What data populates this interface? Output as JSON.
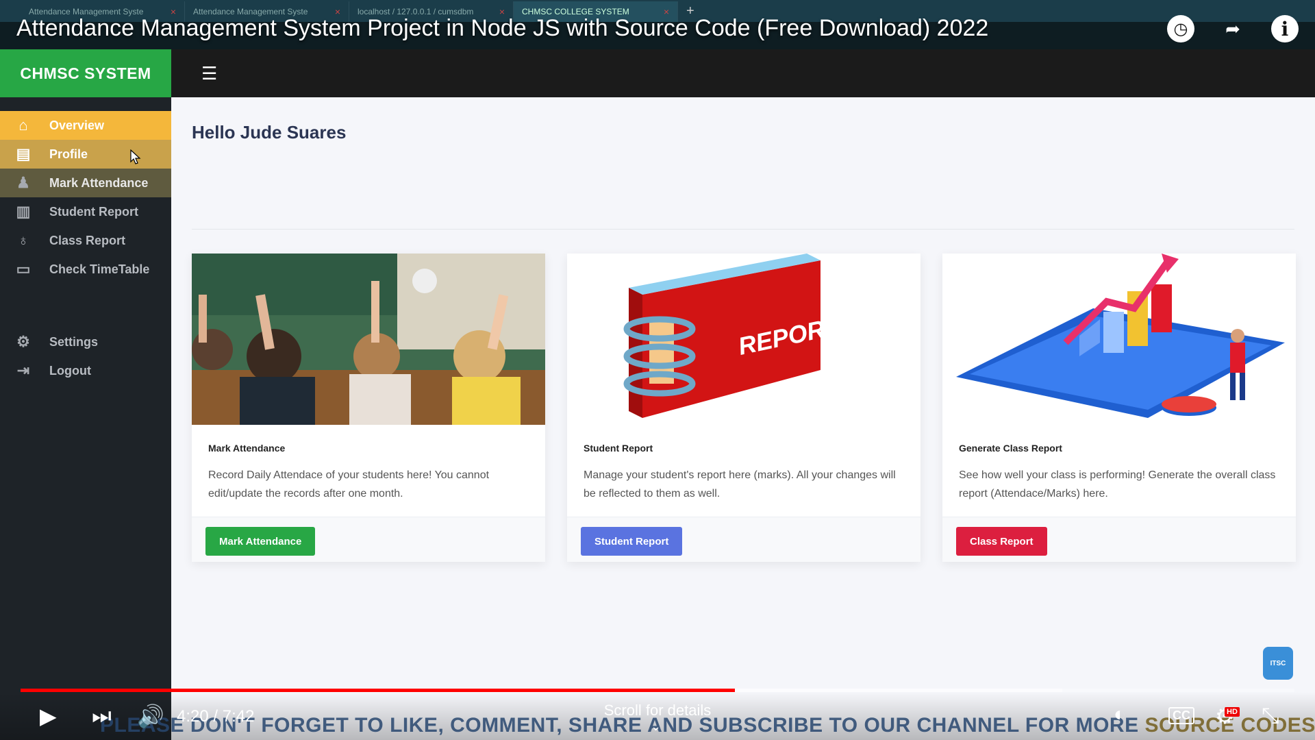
{
  "browser": {
    "tabs": [
      {
        "title": "Attendance Management Syste",
        "active": false
      },
      {
        "title": "Attendance Management Syste",
        "active": false
      },
      {
        "title": "localhost / 127.0.0.1 / cumsdbm",
        "active": false
      },
      {
        "title": "CHMSC COLLEGE SYSTEM",
        "active": true
      }
    ],
    "close_glyph": "×",
    "new_tab_glyph": "+"
  },
  "video": {
    "title": "Attendance Management System Project in Node JS with Source Code (Free Download) 2022",
    "time": "4:20 / 7:42",
    "progress_fraction": 0.561,
    "buffer_fraction": 0.818,
    "scroll_hint": "Scroll for details",
    "banner_main": "PLEASE DON'T FORGET TO LIKE, COMMENT, SHARE AND SUBSCRIBE TO OUR CHANNEL FOR MORE ",
    "banner_highlight": "SOURCE CODES!",
    "hd_badge": "HD",
    "cc_label": "CC",
    "subscribe_label": "ITSC"
  },
  "app": {
    "brand": "CHMSC SYSTEM",
    "nav": [
      {
        "label": "Overview",
        "icon": "home-icon",
        "glyph": "⌂",
        "state": "active"
      },
      {
        "label": "Profile",
        "icon": "id-card-icon",
        "glyph": "▤",
        "state": "hover"
      },
      {
        "label": "Mark Attendance",
        "icon": "teacher-icon",
        "glyph": "♟",
        "state": "hover2"
      },
      {
        "label": "Student Report",
        "icon": "books-icon",
        "glyph": "▥",
        "state": ""
      },
      {
        "label": "Class Report",
        "icon": "award-icon",
        "glyph": "♁",
        "state": ""
      },
      {
        "label": "Check TimeTable",
        "icon": "monitor-icon",
        "glyph": "▭",
        "state": ""
      }
    ],
    "nav_bottom": [
      {
        "label": "Settings",
        "icon": "gear-icon",
        "glyph": "⚙"
      },
      {
        "label": "Logout",
        "icon": "logout-icon",
        "glyph": "⇥"
      }
    ],
    "greeting": "Hello Jude Suares",
    "cards": [
      {
        "title": "Mark Attendance",
        "text": "Record Daily Attendace of your students here! You cannot edit/update the records after one month.",
        "button": "Mark Attendance",
        "button_color": "#28a745",
        "image": "classroom-photo"
      },
      {
        "title": "Student Report",
        "text": "Manage your student's report here (marks). All your changes will be reflected to them as well.",
        "button": "Student Report",
        "button_color": "#5a73e0",
        "image": "report-binder",
        "image_text": "REPORT"
      },
      {
        "title": "Generate Class Report",
        "text": "See how well your class is performing! Generate the overall class report (Attendace/Marks) here.",
        "button": "Class Report",
        "button_color": "#dc1f3f",
        "image": "analytics-illustration"
      }
    ]
  }
}
